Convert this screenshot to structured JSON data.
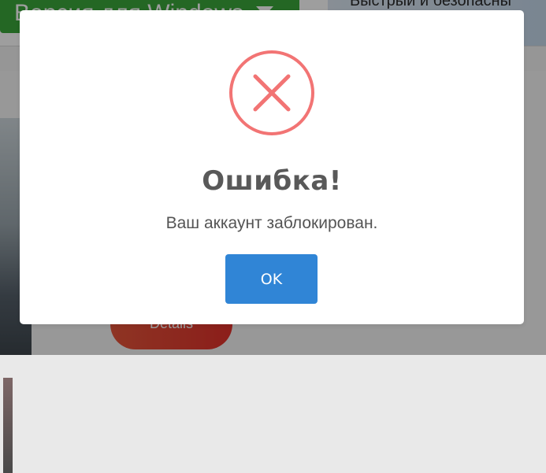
{
  "background": {
    "download_button_label": "Версия для Windows",
    "banner_text": "Быстрый и безопасны",
    "details_button_label": "Details"
  },
  "dialog": {
    "icon": "error-x-icon",
    "icon_color": "#f27474",
    "title": "Ошибка!",
    "message": "Ваш аккаунт заблокирован.",
    "ok_label": "OK",
    "ok_color": "#3085d6"
  }
}
